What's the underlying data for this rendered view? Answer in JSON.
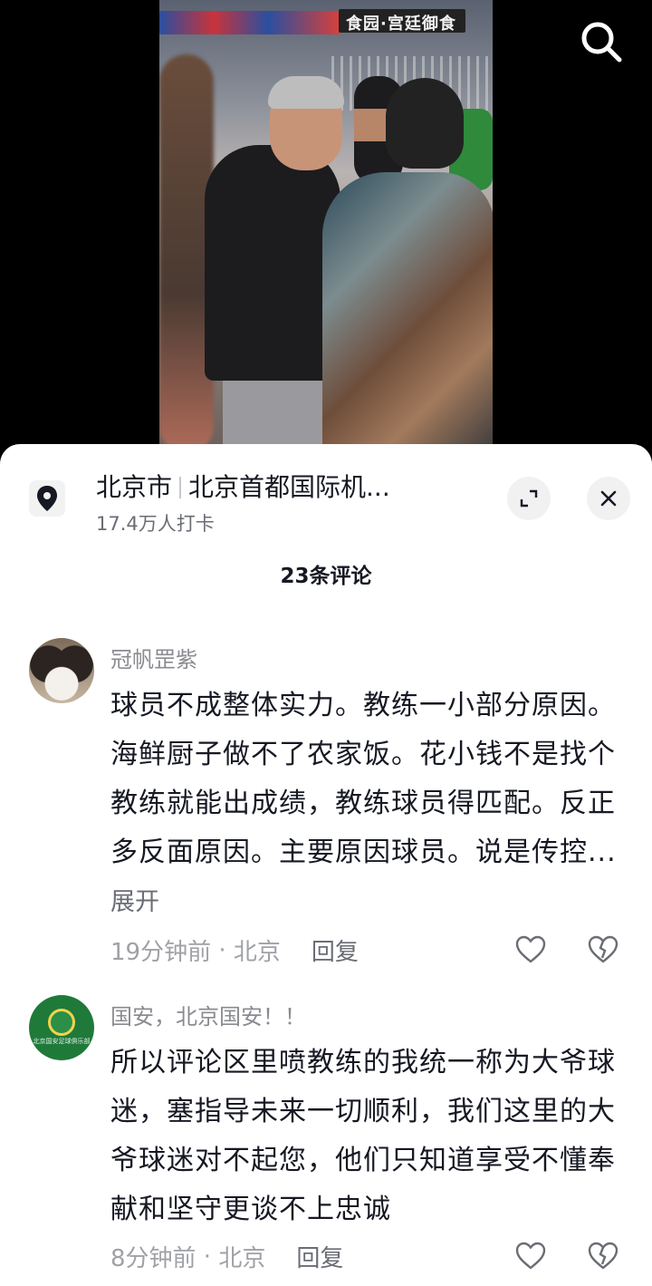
{
  "video": {
    "store_sign": "食园·宫廷御食",
    "search_icon": "search-icon"
  },
  "location": {
    "city": "北京市",
    "place": "北京首都国际机...",
    "checkins": "17.4万人打卡",
    "pin_icon": "location-pin-icon",
    "expand_icon": "expand-icon",
    "close_icon": "close-icon"
  },
  "comments_header": {
    "count_label": "23条评论"
  },
  "comments": [
    {
      "author": "冠帆罡紫",
      "text": "球员不成整体实力。教练一小部分原因。海鲜厨子做不了农家饭。花小钱不是找个教练就能出成绩，教练球员得匹配。反正多反面原因。主要原因球员。说是传控...",
      "more": "展开",
      "time": "19分钟前",
      "location": "北京",
      "reply": "回复",
      "avatar": "dog-avatar"
    },
    {
      "author": "国安，北京国安！！",
      "text": "所以评论区里喷教练的我统一称为大爷球迷，塞指导未来一切顺利，我们这里的大爷球迷对不起您，他们只知道享受不懂奉献和坚守更谈不上忠诚",
      "time": "8分钟前",
      "location": "北京",
      "reply": "回复",
      "avatar": "guoan-logo-avatar",
      "avatar_caption": "北京国安足球俱乐部"
    }
  ],
  "colors": {
    "sheet_bg": "#ffffff",
    "text_primary": "#161823",
    "text_secondary": "#8a8b91",
    "guoan_green": "#1f7a3a"
  }
}
